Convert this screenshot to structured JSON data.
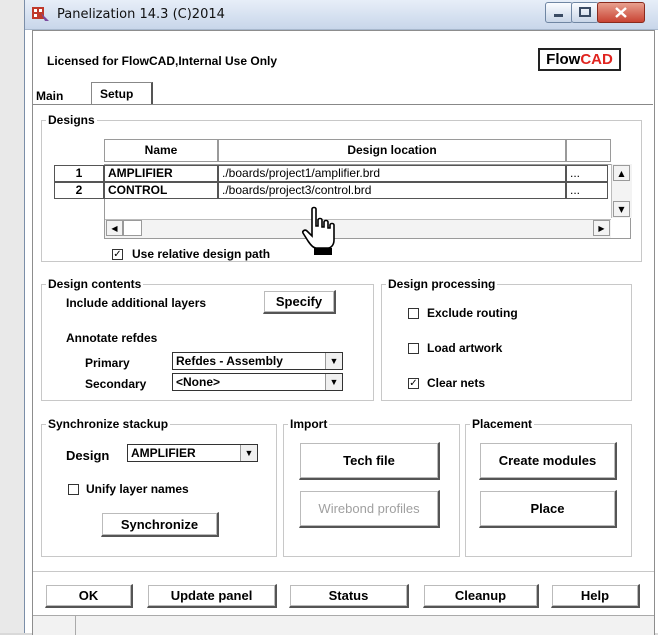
{
  "window": {
    "title": "Panelization 14.3 (C)2014"
  },
  "license": {
    "text": "Licensed for FlowCAD,Internal Use Only",
    "logo_flow": "Flow",
    "logo_cad": "CAD"
  },
  "tabs": [
    {
      "label": "Main",
      "active": false
    },
    {
      "label": "Setup",
      "active": true
    }
  ],
  "designs": {
    "group_label": "Designs",
    "columns": [
      "Name",
      "Design location"
    ],
    "rows": [
      {
        "num": "1",
        "name": "AMPLIFIER",
        "location": "./boards/project1/amplifier.brd",
        "browse": "..."
      },
      {
        "num": "2",
        "name": "CONTROL",
        "location": "./boards/project3/control.brd",
        "browse": "..."
      }
    ],
    "relative_path_label": "Use relative design path",
    "relative_path_checked": true
  },
  "design_contents": {
    "group_label": "Design contents",
    "include_layers_label": "Include additional layers",
    "specify_button": "Specify",
    "annotate_label": "Annotate refdes",
    "primary_label": "Primary",
    "primary_value": "Refdes - Assembly",
    "secondary_label": "Secondary",
    "secondary_value": "<None>"
  },
  "design_processing": {
    "group_label": "Design processing",
    "options": [
      {
        "label": "Exclude routing",
        "checked": false
      },
      {
        "label": "Load artwork",
        "checked": false
      },
      {
        "label": "Clear nets",
        "checked": true
      }
    ]
  },
  "sync_stackup": {
    "group_label": "Synchronize stackup",
    "design_label": "Design",
    "design_value": "AMPLIFIER",
    "unify_label": "Unify layer names",
    "unify_checked": false,
    "sync_button": "Synchronize"
  },
  "import": {
    "group_label": "Import",
    "tech_file_button": "Tech file",
    "wirebond_button": "Wirebond profiles"
  },
  "placement": {
    "group_label": "Placement",
    "create_modules_button": "Create modules",
    "place_button": "Place"
  },
  "bottom_buttons": {
    "ok": "OK",
    "update_panel": "Update panel",
    "status": "Status",
    "cleanup": "Cleanup",
    "help": "Help"
  },
  "colors": {
    "logo_red": "#e0241f",
    "title_gradient_top": "#e7eef8",
    "close_red": "#c94434"
  }
}
